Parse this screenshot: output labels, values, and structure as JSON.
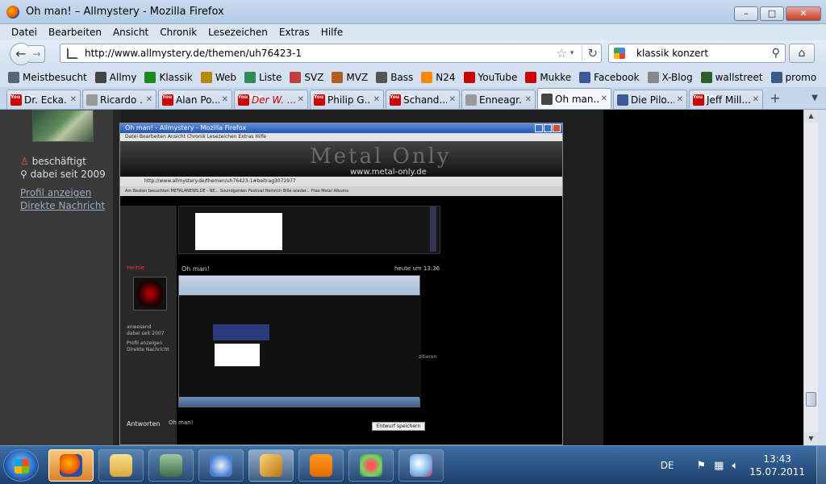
{
  "window": {
    "title": "Oh man! – Allmystery - Mozilla Firefox",
    "buttons": {
      "minimize": "–",
      "maximize": "□",
      "close": "✕"
    }
  },
  "menu": [
    "Datei",
    "Bearbeiten",
    "Ansicht",
    "Chronik",
    "Lesezeichen",
    "Extras",
    "Hilfe"
  ],
  "nav": {
    "url": "http://www.allmystery.de/themen/uh76423-1",
    "search_value": "klassik konzert",
    "back_glyph": "←",
    "forward_glyph": "→",
    "star_glyph": "☆",
    "drop_glyph": "▾",
    "reload_glyph": "↻",
    "search_glyph": "⚲",
    "home_glyph": "⌂"
  },
  "bookmarks": [
    {
      "label": "Meistbesucht",
      "icon": "bookmark-icon",
      "color": "#556677"
    },
    {
      "label": "Allmy",
      "icon": "allmy-icon",
      "color": "#444444"
    },
    {
      "label": "Klassik",
      "icon": "klassik-icon",
      "color": "#1a8a1a"
    },
    {
      "label": "Web",
      "icon": "web-icon",
      "color": "#b8860b"
    },
    {
      "label": "Liste",
      "icon": "liste-icon",
      "color": "#2e8b57"
    },
    {
      "label": "SVZ",
      "icon": "svz-icon",
      "color": "#c04040"
    },
    {
      "label": "MVZ",
      "icon": "mvz-icon",
      "color": "#b06020"
    },
    {
      "label": "Bass",
      "icon": "bass-icon",
      "color": "#555555"
    },
    {
      "label": "N24",
      "icon": "n24-icon",
      "color": "#ff8800"
    },
    {
      "label": "YouTube",
      "icon": "youtube-icon",
      "color": "#cc0000"
    },
    {
      "label": "Mukke",
      "icon": "youtube-icon",
      "color": "#cc0000"
    },
    {
      "label": "Facebook",
      "icon": "facebook-icon",
      "color": "#3b5998"
    },
    {
      "label": "X-Blog",
      "icon": "page-icon",
      "color": "#888888"
    },
    {
      "label": "wallstreet",
      "icon": "wallstreet-icon",
      "color": "#2e5e2e"
    },
    {
      "label": "promo",
      "icon": "promo-icon",
      "color": "#3a5a8c"
    }
  ],
  "tabs": [
    {
      "label": "Dr. Ecka...",
      "icon": "youtube-icon",
      "color": "#cc0000",
      "active": false,
      "red": false
    },
    {
      "label": "Ricardo ...",
      "icon": "page-icon",
      "color": "#999999",
      "active": false,
      "red": false
    },
    {
      "label": "Alan Po...",
      "icon": "youtube-icon",
      "color": "#cc0000",
      "active": false,
      "red": false
    },
    {
      "label": "Der W. ...",
      "icon": "youtube-icon",
      "color": "#cc0000",
      "active": false,
      "red": true
    },
    {
      "label": "Philip G...",
      "icon": "youtube-icon",
      "color": "#cc0000",
      "active": false,
      "red": false
    },
    {
      "label": "Schand...",
      "icon": "youtube-icon",
      "color": "#cc0000",
      "active": false,
      "red": false
    },
    {
      "label": "Enneagr...",
      "icon": "page-icon",
      "color": "#999999",
      "active": false,
      "red": false
    },
    {
      "label": "Oh man...",
      "icon": "allmy-icon",
      "color": "#444444",
      "active": true,
      "red": false
    },
    {
      "label": "Die Pilo...",
      "icon": "facebook-icon",
      "color": "#3b5998",
      "active": false,
      "red": false
    },
    {
      "label": "Jeff Mill...",
      "icon": "youtube-icon",
      "color": "#cc0000",
      "active": false,
      "red": false
    }
  ],
  "tab_close": "✕",
  "tab_new": "+",
  "tab_list": "▼",
  "youtube_badge": "You Tube",
  "sidebar": {
    "status": "beschäftigt",
    "since": "dabei seit 2009",
    "profile_link": "Profil anzeigen",
    "message_link": "Direkte Nachricht"
  },
  "nested": {
    "title": "Oh man! - Allmystery - Mozilla Firefox",
    "menu": "Datei  Bearbeiten  Ansicht  Chronik  Lesezeichen  Extras  Hilfe",
    "banner_logo": "Metal Only",
    "banner_site": "www.metal-only.de",
    "url": "http://www.allmystery.de/themen/uh76423-1#beitrag3072977",
    "bookmarks": "Am Besten besuchten  METAL4NEWS.DE - NE...  Soundgarden Festival  Heinrich Bille wieder...  Free Metal Albums",
    "author": "Heinie",
    "post_title": "Oh man!",
    "time": "heute um 13:36",
    "side_status": "anwesend",
    "side_since": "dabei seit 2007",
    "side_profile": "Profil anzeigen",
    "side_message": "Direkte Nachricht",
    "quote": "zitieren",
    "reply_label": "Antworten",
    "reply_title": "Oh man!",
    "draft_button": "Entwurf speichern"
  },
  "taskbar": {
    "apps": [
      {
        "name": "firefox-icon",
        "active": true
      },
      {
        "name": "explorer-icon",
        "active": false
      },
      {
        "name": "terminal-icon",
        "active": false
      },
      {
        "name": "thunderbird-icon",
        "active": false
      },
      {
        "name": "winamp-icon",
        "active": true
      },
      {
        "name": "vlc-icon",
        "active": false
      },
      {
        "name": "icq-icon",
        "active": false
      },
      {
        "name": "paint-icon",
        "active": false
      }
    ],
    "language": "DE",
    "time": "13:43",
    "date": "15.07.2011"
  }
}
